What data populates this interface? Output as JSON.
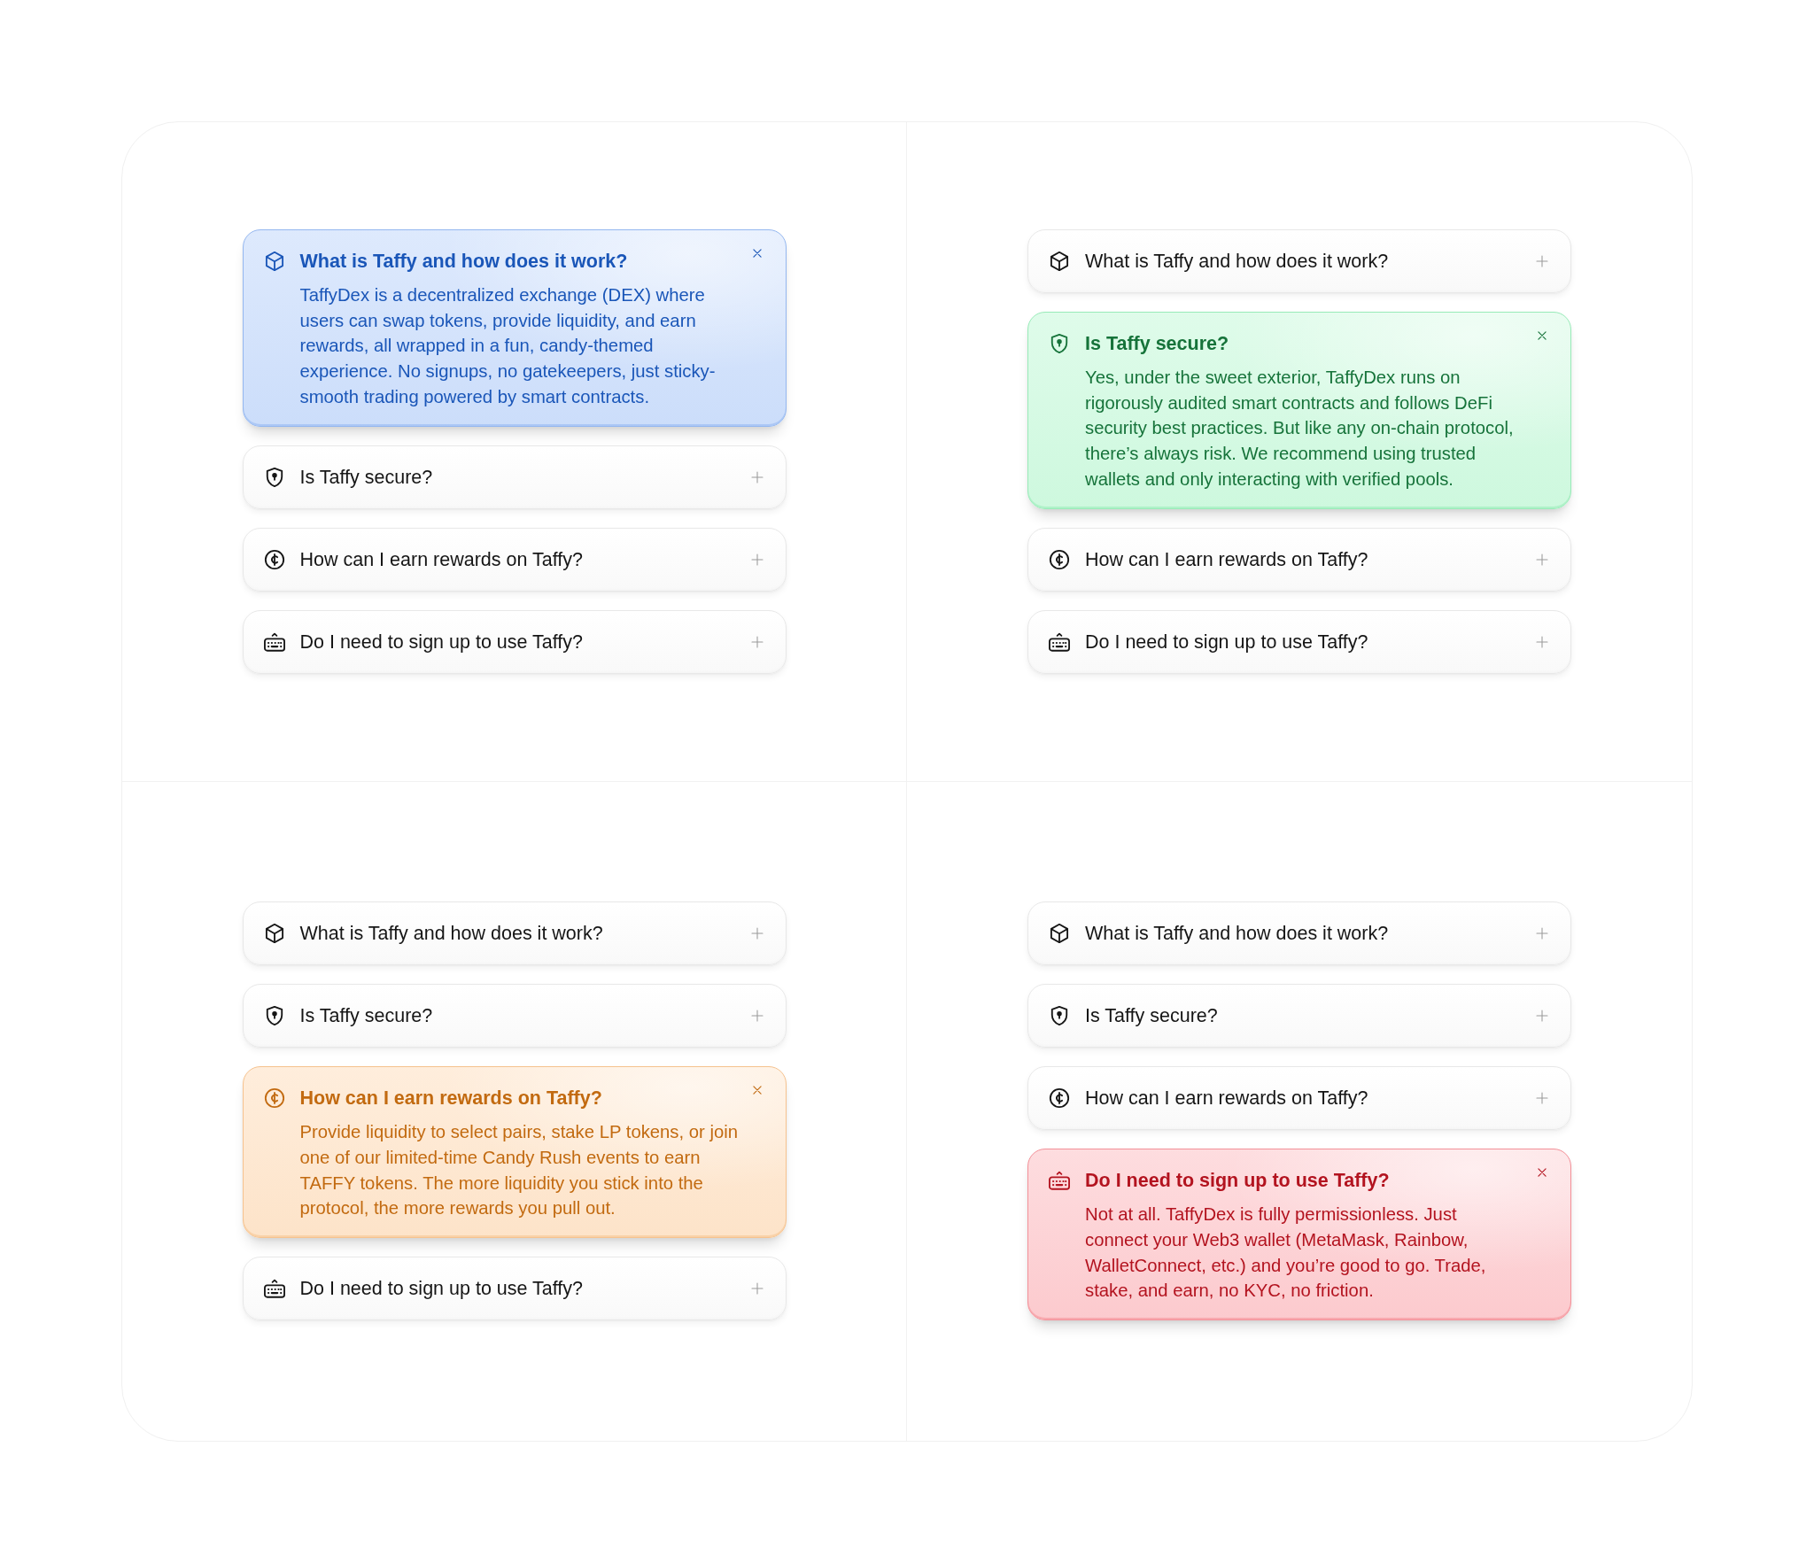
{
  "panels": [
    {
      "color": "#1a56b8",
      "items": [
        {
          "kind": "cube",
          "question": "What is Taffy and how does it work?",
          "expanded": true,
          "answer": "TaffyDex is a decentralized exchange (DEX) where users can swap tokens, provide liquidity, and earn rewards, all wrapped in a fun, candy-themed experience. No signups, no gatekeepers, just sticky-smooth trading powered by smart contracts."
        },
        {
          "kind": "shield",
          "question": "Is Taffy secure?",
          "expanded": false
        },
        {
          "kind": "coin",
          "question": "How can I earn rewards on Taffy?",
          "expanded": false
        },
        {
          "kind": "keyboard",
          "question": "Do I need to sign up to use Taffy?",
          "expanded": false
        }
      ]
    },
    {
      "color": "#16733a",
      "items": [
        {
          "kind": "cube",
          "question": "What is Taffy and how does it work?",
          "expanded": false
        },
        {
          "kind": "shield",
          "question": "Is Taffy secure?",
          "expanded": true,
          "answer": "Yes, under the sweet exterior, TaffyDex runs on rigorously audited smart contracts and follows DeFi security best practices. But like any on-chain protocol, there’s always risk. We recommend using trusted wallets and only interacting with verified pools."
        },
        {
          "kind": "coin",
          "question": "How can I earn rewards on Taffy?",
          "expanded": false
        },
        {
          "kind": "keyboard",
          "question": "Do I need to sign up to use Taffy?",
          "expanded": false
        }
      ]
    },
    {
      "color": "#c26a10",
      "items": [
        {
          "kind": "cube",
          "question": "What is Taffy and how does it work?",
          "expanded": false
        },
        {
          "kind": "shield",
          "question": "Is Taffy secure?",
          "expanded": false
        },
        {
          "kind": "coin",
          "question": "How can I earn rewards on Taffy?",
          "expanded": true,
          "answer": "Provide liquidity to select pairs, stake LP tokens, or join one of our limited-time Candy Rush events to earn TAFFY tokens. The more liquidity you stick into the protocol, the more rewards you pull out."
        },
        {
          "kind": "keyboard",
          "question": "Do I need to sign up to use Taffy?",
          "expanded": false
        }
      ]
    },
    {
      "color": "#b3131f",
      "items": [
        {
          "kind": "cube",
          "question": "What is Taffy and how does it work?",
          "expanded": false
        },
        {
          "kind": "shield",
          "question": "Is Taffy secure?",
          "expanded": false
        },
        {
          "kind": "coin",
          "question": "How can I earn rewards on Taffy?",
          "expanded": false
        },
        {
          "kind": "keyboard",
          "question": "Do I need to sign up to use Taffy?",
          "expanded": true,
          "answer": "Not at all. TaffyDex is fully permissionless. Just connect your Web3 wallet (MetaMask, Rainbow, WalletConnect, etc.) and you’re good to go. Trade, stake, and earn, no KYC, no friction."
        }
      ]
    }
  ]
}
